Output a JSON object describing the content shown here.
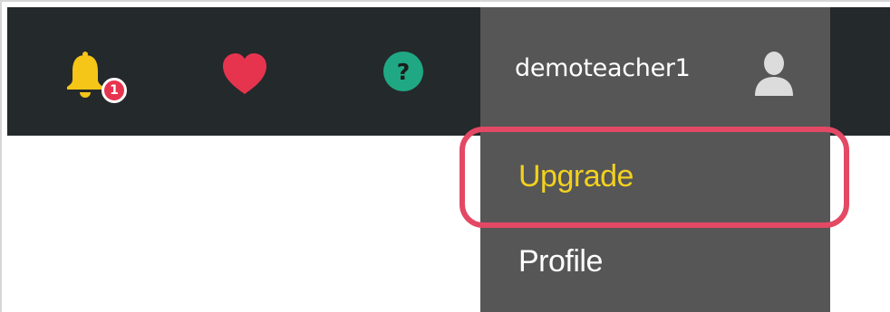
{
  "navbar": {
    "notifications": {
      "icon": "bell-icon",
      "color": "#f5c518",
      "count": "1",
      "badge_color": "#e6344f"
    },
    "favorites": {
      "icon": "heart-icon",
      "color": "#e6344f"
    },
    "help": {
      "icon": "help-circle-icon",
      "color": "#1fa883",
      "glyph": "?"
    },
    "user": {
      "username": "demoteacher1",
      "icon": "user-avatar-icon"
    }
  },
  "user_dropdown": {
    "items": [
      {
        "label": "Upgrade",
        "color": "#f2d11f",
        "highlighted": true
      },
      {
        "label": "Profile",
        "color": "#ffffff"
      }
    ]
  },
  "highlight_color": "#e34964"
}
